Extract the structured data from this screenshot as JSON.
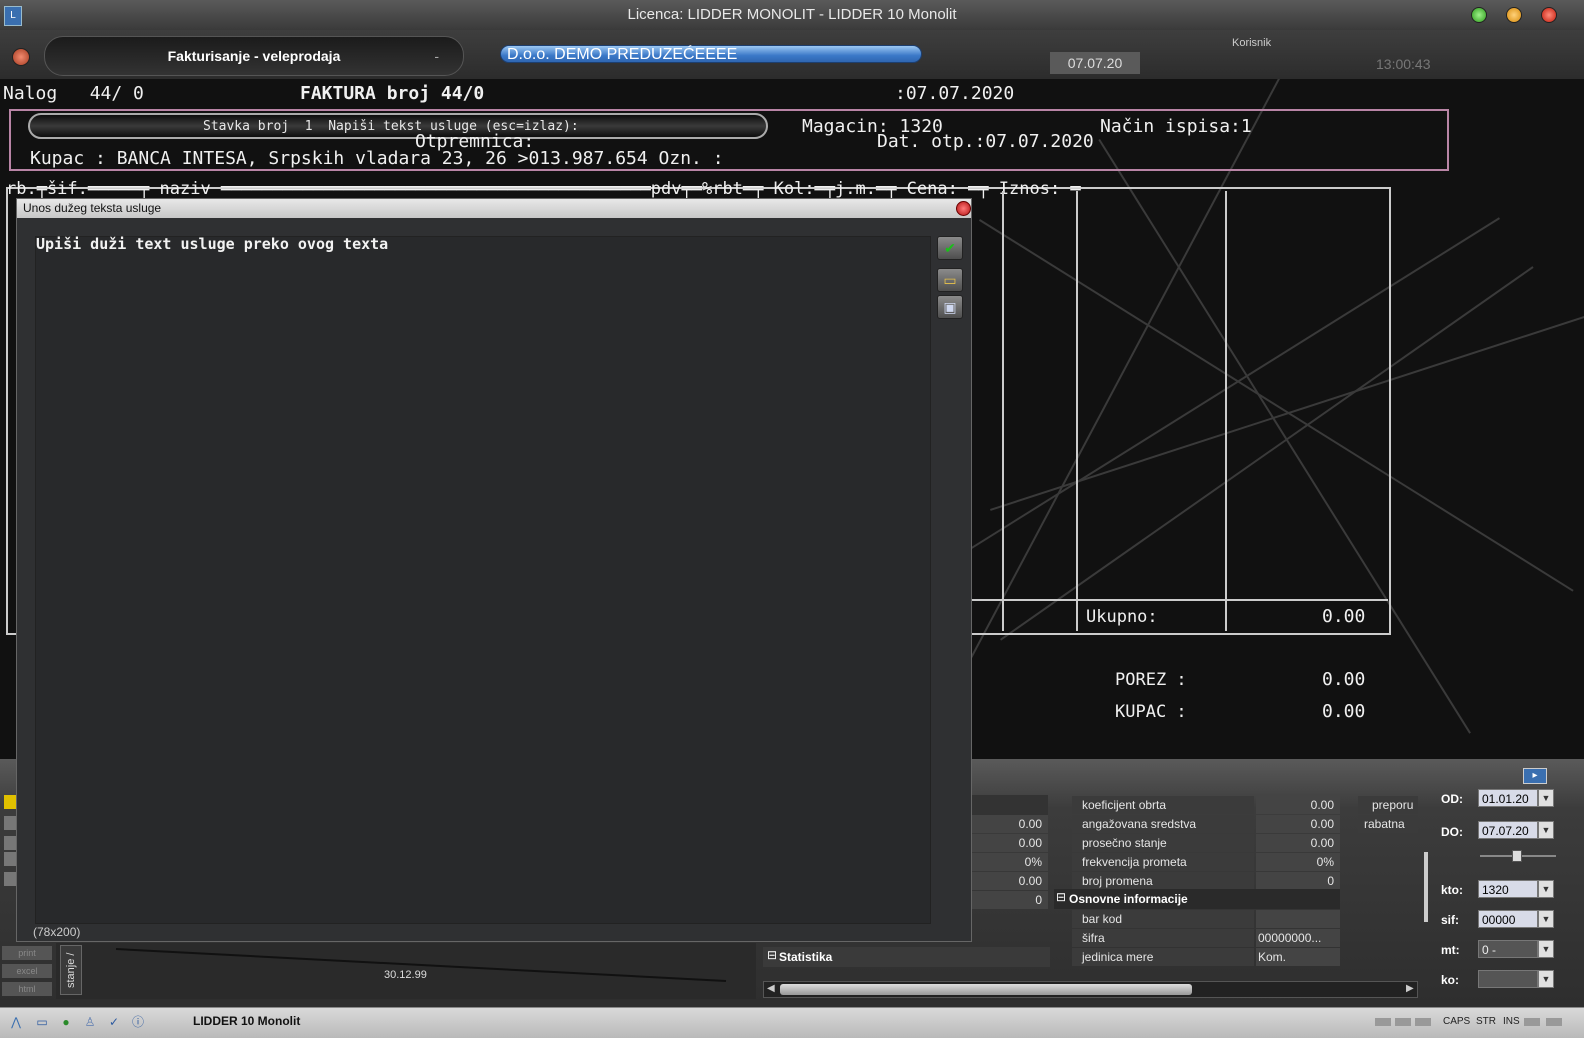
{
  "window": {
    "title": "Licenca: LIDDER MONOLIT - LIDDER 10 Monolit"
  },
  "header": {
    "module": "Fakturisanje - veleprodaja",
    "module_dash": "-",
    "company": "D.o.o. DEMO PREDUZEĆEEEE",
    "date": "07.07.20",
    "user_label": "Korisnik",
    "time": "13:00:43"
  },
  "terminal": {
    "nalog": "Nalog   44/ 0",
    "faktura": "FAKTURA broj 44/0",
    "faktura_date": ":07.07.2020",
    "prompt": "Stavka broj  1  Napiši tekst usluge (esc=izlaz):",
    "magacin": "Magacin: 1320",
    "nacin": "Način ispisa:1",
    "otpremnica": "Otpremnica:",
    "dat_otp": "Dat. otp.:07.07.2020",
    "kupac_line": "Kupac : BANCA INTESA, Srpskih vladara 23, 26 >013.987.654 Ozn. :",
    "columns": "rb.╤šif.═════╤ naziv ══════════════════════════════════════════pdv╤═%rbt═╤ Kol:═╤j.m.═╤ Cena: ═╤ Iznos: ═",
    "ukupno_label": "Ukupno:",
    "ukupno_value": "0.00",
    "porez_label": "POREZ :",
    "porez_value": "0.00",
    "kupac_label": "KUPAC :",
    "kupac_value": "0.00"
  },
  "dialog": {
    "title": "Unos dužeg teksta usluge",
    "text": "Upiši duži text usluge preko ovog texta",
    "dimensions": "(78x200)",
    "buttons": [
      {
        "icon": "confirm-icon",
        "glyph": "✔"
      },
      {
        "icon": "open-folder-icon",
        "glyph": "▭"
      },
      {
        "icon": "save-icon",
        "glyph": "▣"
      }
    ]
  },
  "stats_left": {
    "values": [
      "0.00",
      "0.00",
      "0%",
      "0.00",
      "0"
    ],
    "section": "Statistika"
  },
  "stats_right": {
    "rows": [
      {
        "label": "koeficijent obrta",
        "value": "0.00"
      },
      {
        "label": "angažovana sredstva",
        "value": "0.00"
      },
      {
        "label": "prosečno stanje",
        "value": "0.00"
      },
      {
        "label": "frekvencija prometa",
        "value": "0%"
      },
      {
        "label": "broj promena",
        "value": "0"
      }
    ],
    "section": "Osnovne informacije",
    "info_rows": [
      {
        "label": "bar kod",
        "value": ""
      },
      {
        "label": "šifra",
        "value": "00000000..."
      },
      {
        "label": "jedinica mere",
        "value": "Kom."
      }
    ],
    "extra_tabs": [
      "preporu",
      "rabatna"
    ]
  },
  "chart": {
    "x_label": "30.12.99",
    "tab": "stanje /"
  },
  "export_buttons": [
    "print",
    "excel",
    "html"
  ],
  "filters": {
    "od_label": "OD:",
    "od_value": "01.01.20",
    "do_label": "DO:",
    "do_value": "07.07.20",
    "kto_label": "kto:",
    "kto_value": "1320",
    "sif_label": "sif:",
    "sif_value": "00000",
    "mt_label": "mt:",
    "mt_value": "0 -",
    "ko_label": "ko:",
    "ko_value": ""
  },
  "statusbar": {
    "app_name": "LIDDER 10 Monolit",
    "caps": "CAPS",
    "str": "STR",
    "ins": "INS"
  },
  "colors": {
    "accent_blue": "#3a78c8",
    "dialog_bg": "#2f3032",
    "terminal_bg": "#111111"
  }
}
